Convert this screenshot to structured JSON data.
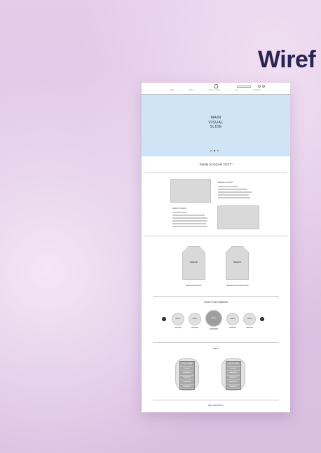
{
  "heading": "Wiref",
  "mockup": {
    "nav": [
      "HOME",
      "ABOUT",
      "PRODUCT/STORE",
      "GIFT",
      "COMMUNITY"
    ],
    "hero": {
      "line1": "MAIN",
      "line2": "VISUAL",
      "line3": "SLIDE"
    },
    "slogan": "\"MAIN SLOGAN TEXT\"",
    "story": {
      "brand_story": "BRAND STORY",
      "about_logo": "ABOUT LOGO"
    },
    "products": {
      "image1": "IMAGE",
      "image2": "IMAGE",
      "new_label": "NEW PRODUCT",
      "seasonal_label": "SEASONAL PRODUCT"
    },
    "recommend": {
      "title": "TODAY'S RECOMMEND",
      "items": [
        "IMAGE",
        "IMAGE",
        "IMAGE",
        "IMAGE",
        "IMAGE"
      ],
      "prev": "‹",
      "next": "›"
    },
    "best": {
      "title": "BEST",
      "left_rows": [
        "PRODUCT NAME",
        "PRODUCT DESCRIPTION",
        "PRODUCT DESCRIPTION",
        "PRODUCT DESCRIPTION",
        "PRODUCT DESCRIPTION",
        "PRODUCT DESCRIPTION"
      ],
      "right_rows": [
        "PRODUCT NAME",
        "PRODUCT DESCRIPTION",
        "PRODUCT DESCRIPTION",
        "PRODUCT DESCRIPTION",
        "PRODUCT DESCRIPTION",
        "PRODUCT DESCRIPTION"
      ]
    },
    "gift": "GIFT PRODUCT"
  }
}
